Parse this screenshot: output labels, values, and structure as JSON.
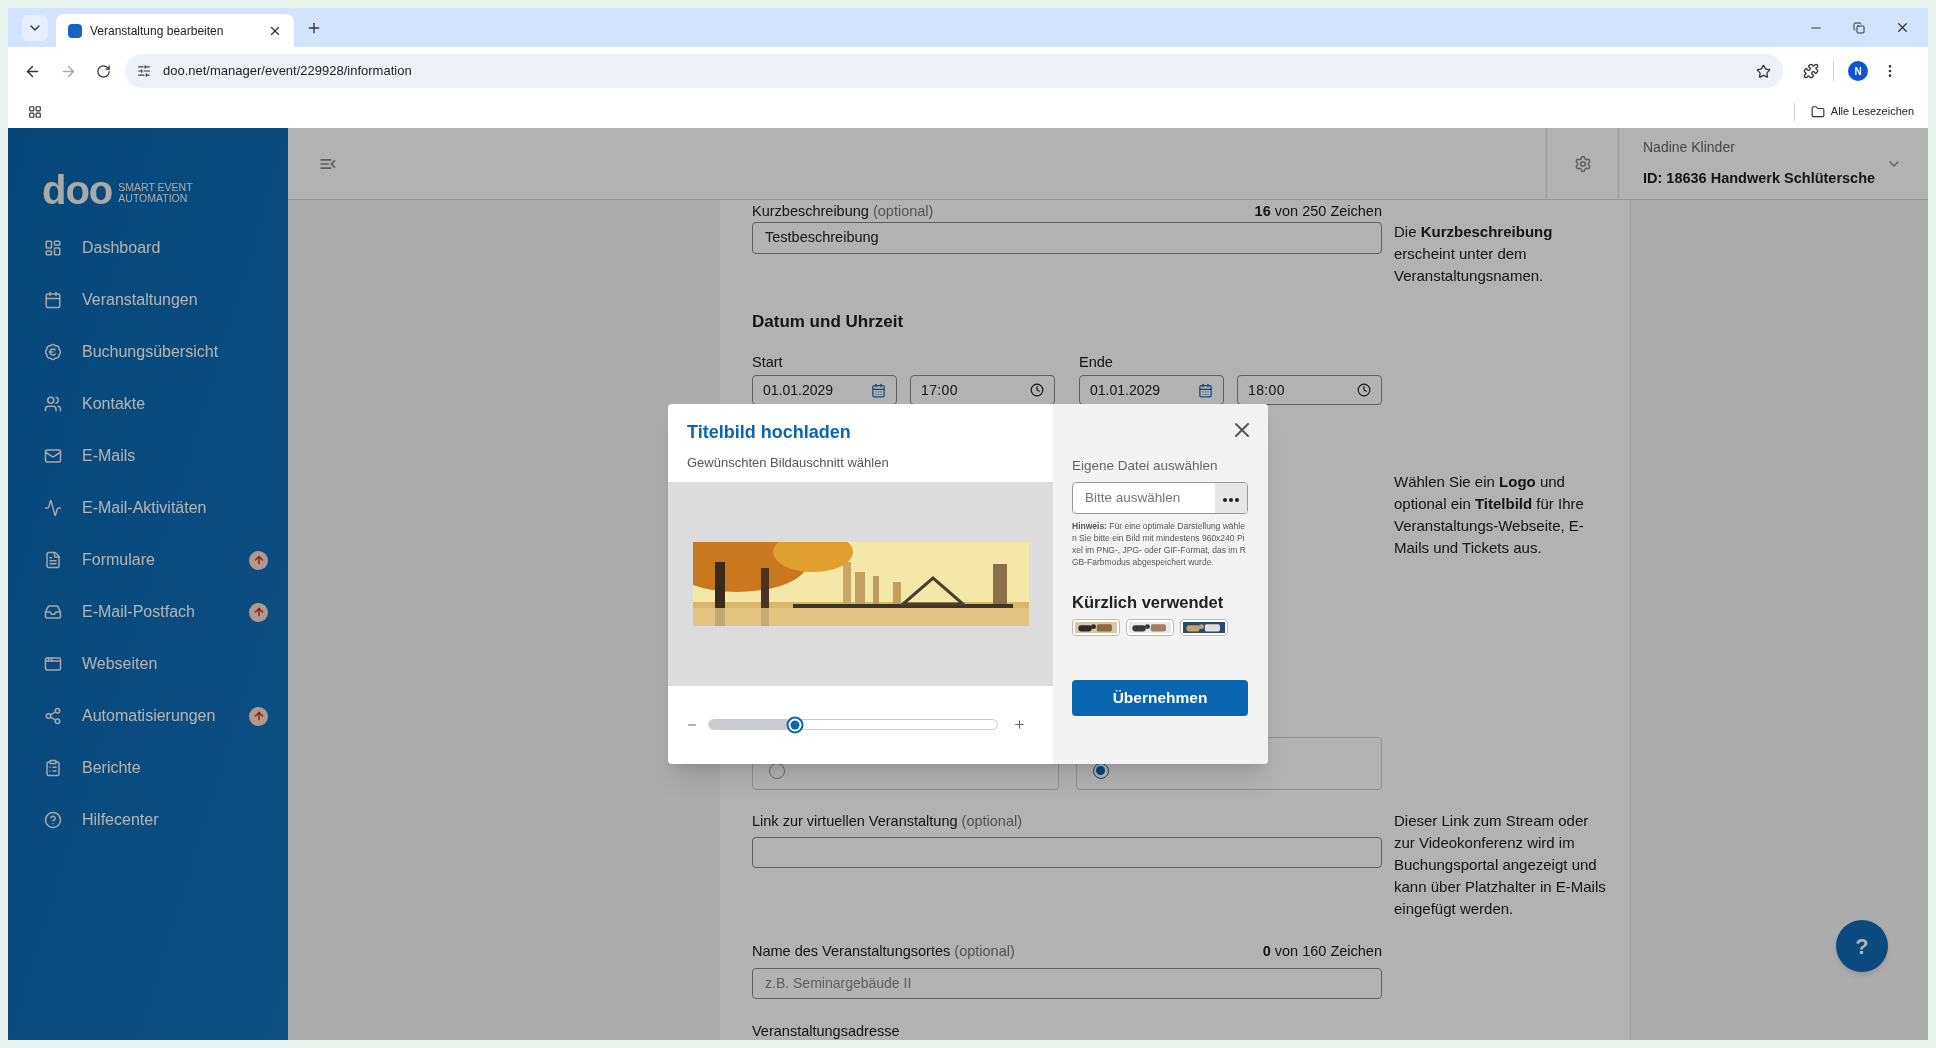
{
  "browser": {
    "tab_title": "Veranstaltung bearbeiten",
    "url": "doo.net/manager/event/229928/information",
    "profile_initial": "N",
    "bookmarks_label": "Alle Lesezeichen"
  },
  "sidebar": {
    "logo": {
      "wordmark": "doo",
      "tagline": [
        "SMART EVENT",
        "AUTOMATION"
      ]
    },
    "items": [
      {
        "label": "Dashboard",
        "kind": "dashboard",
        "badge": false
      },
      {
        "label": "Veranstaltungen",
        "kind": "calendar",
        "badge": false
      },
      {
        "label": "Buchungsübersicht",
        "kind": "euro",
        "badge": false
      },
      {
        "label": "Kontakte",
        "kind": "contacts",
        "badge": false
      },
      {
        "label": "E-Mails",
        "kind": "mail",
        "badge": false
      },
      {
        "label": "E-Mail-Aktivitäten",
        "kind": "activity",
        "badge": false
      },
      {
        "label": "Formulare",
        "kind": "form",
        "badge": true
      },
      {
        "label": "E-Mail-Postfach",
        "kind": "inbox",
        "badge": true
      },
      {
        "label": "Webseiten",
        "kind": "website",
        "badge": false
      },
      {
        "label": "Automatisierungen",
        "kind": "automation",
        "badge": true
      },
      {
        "label": "Berichte",
        "kind": "report",
        "badge": false
      },
      {
        "label": "Hilfecenter",
        "kind": "help",
        "badge": false
      }
    ]
  },
  "header": {
    "user_name": "Nadine Klinder",
    "account": "ID: 18636  Handwerk Schlütersche"
  },
  "form": {
    "short_description": {
      "label": "Kurzbeschreibung",
      "optional": "(optional)",
      "count": "**16** von 250 Zeichen",
      "value": "Testbeschreibung",
      "help": "Die **Kurzbeschreibung** erscheint unter dem Veranstaltungsnamen."
    },
    "date_time": {
      "heading": "Datum und Uhrzeit",
      "start": {
        "label": "Start",
        "date": "01.01.2029",
        "time": "17:00"
      },
      "end": {
        "label": "Ende",
        "date": "01.01.2029",
        "time": "18:00"
      }
    },
    "media_help": "Wählen Sie ein **Logo** und optional ein **Titelbild** für Ihre Veranstaltungs-Webseite, E-Mails und Tickets aus.",
    "location_types": [
      {
        "selected": false
      },
      {
        "selected": true
      }
    ],
    "virtual_link": {
      "label": "Link zur virtuellen Veranstaltung",
      "optional": "(optional)",
      "help": "Dieser Link zum Stream oder zur Videokonferenz wird im Buchungsportal angezeigt und kann über Platzhalter in E-Mails eingefügt werden."
    },
    "venue_name": {
      "label": "Name des Veranstaltungsortes",
      "optional": "(optional)",
      "count": "**0** von 160 Zeichen",
      "placeholder": "z.B. Seminargebäude II"
    },
    "address_label": "Veranstaltungsadresse"
  },
  "help_button": "?",
  "modal": {
    "title": "Titelbild hochladen",
    "subtitle": "Gewünschten Bildauschnitt wählen",
    "zoom": {
      "level": 0.3
    },
    "file": {
      "label": "Eigene Datei auswählen",
      "placeholder": "Bitte auswählen"
    },
    "hint": "**Hinweis:** Für eine optimale Darstellung wählen Sie bitte ein Bild mit mindestens 960x240 Pixel im PNG-, JPG- oder GIF-Format, das im RGB-Farbmodus abgespeichert wurde.",
    "recent_heading": "Kürzlich verwendet",
    "apply_button": "Übernehmen"
  }
}
